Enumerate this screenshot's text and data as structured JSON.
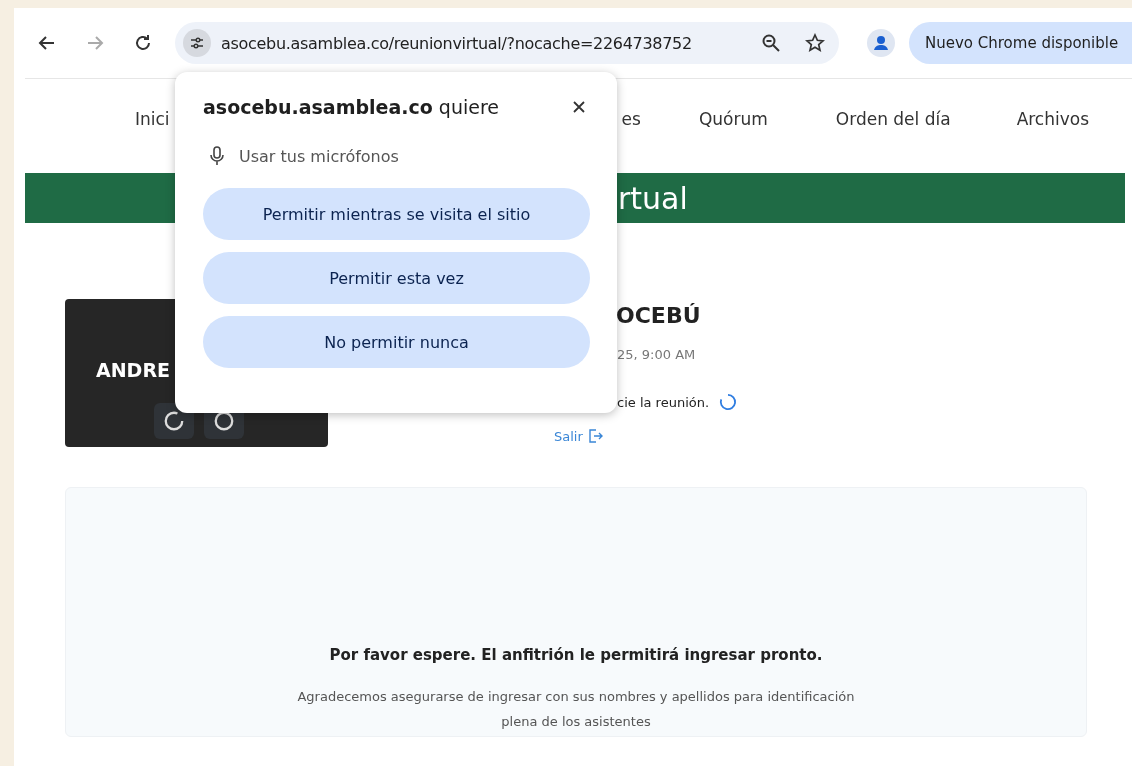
{
  "toolbar": {
    "url": "asocebu.asamblea.co/reunionvirtual/?nocache=2264738752",
    "update_button": "Nuevo Chrome disponible"
  },
  "nav": [
    {
      "label": "Inici"
    },
    {
      "label": "es"
    },
    {
      "label": "Quórum"
    },
    {
      "label": "Orden del día"
    },
    {
      "label": "Archivos"
    }
  ],
  "banner": {
    "title": "rtual"
  },
  "video_tile": {
    "name": "ANDRE"
  },
  "meeting": {
    "title": "OCEBÚ",
    "date": "25, 9:00 AM",
    "status": "cie la reunión.",
    "exit_link": "Salir"
  },
  "waiting_panel": {
    "heading": "Por favor espere. El anfitrión le permitirá ingresar pronto.",
    "note": "Agradecemos asegurarse de ingresar con sus nombres y apellidos para identificación plena de los asistentes"
  },
  "permission_popup": {
    "site": "asocebu.asamblea.co",
    "verb": "quiere",
    "request": "Usar tus micrófonos",
    "buttons": [
      "Permitir mientras se visita el sitio",
      "Permitir esta vez",
      "No permitir nunca"
    ]
  }
}
